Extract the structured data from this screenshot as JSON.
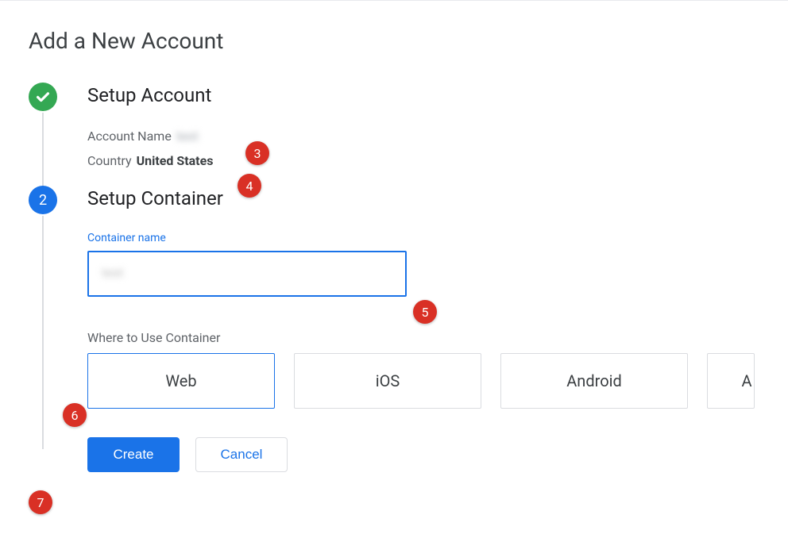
{
  "page": {
    "title": "Add a New Account"
  },
  "step1": {
    "title": "Setup Account",
    "accountNameLabel": "Account Name",
    "accountNameValue": "test",
    "countryLabel": "Country",
    "countryValue": "United States"
  },
  "step2": {
    "number": "2",
    "title": "Setup Container",
    "containerNameLabel": "Container name",
    "containerNameValue": "test",
    "whereLabel": "Where to Use Container",
    "options": {
      "web": "Web",
      "ios": "iOS",
      "android": "Android",
      "amp": "A"
    }
  },
  "buttons": {
    "create": "Create",
    "cancel": "Cancel"
  },
  "annotations": {
    "a3": "3",
    "a4": "4",
    "a5": "5",
    "a6": "6",
    "a7": "7"
  }
}
